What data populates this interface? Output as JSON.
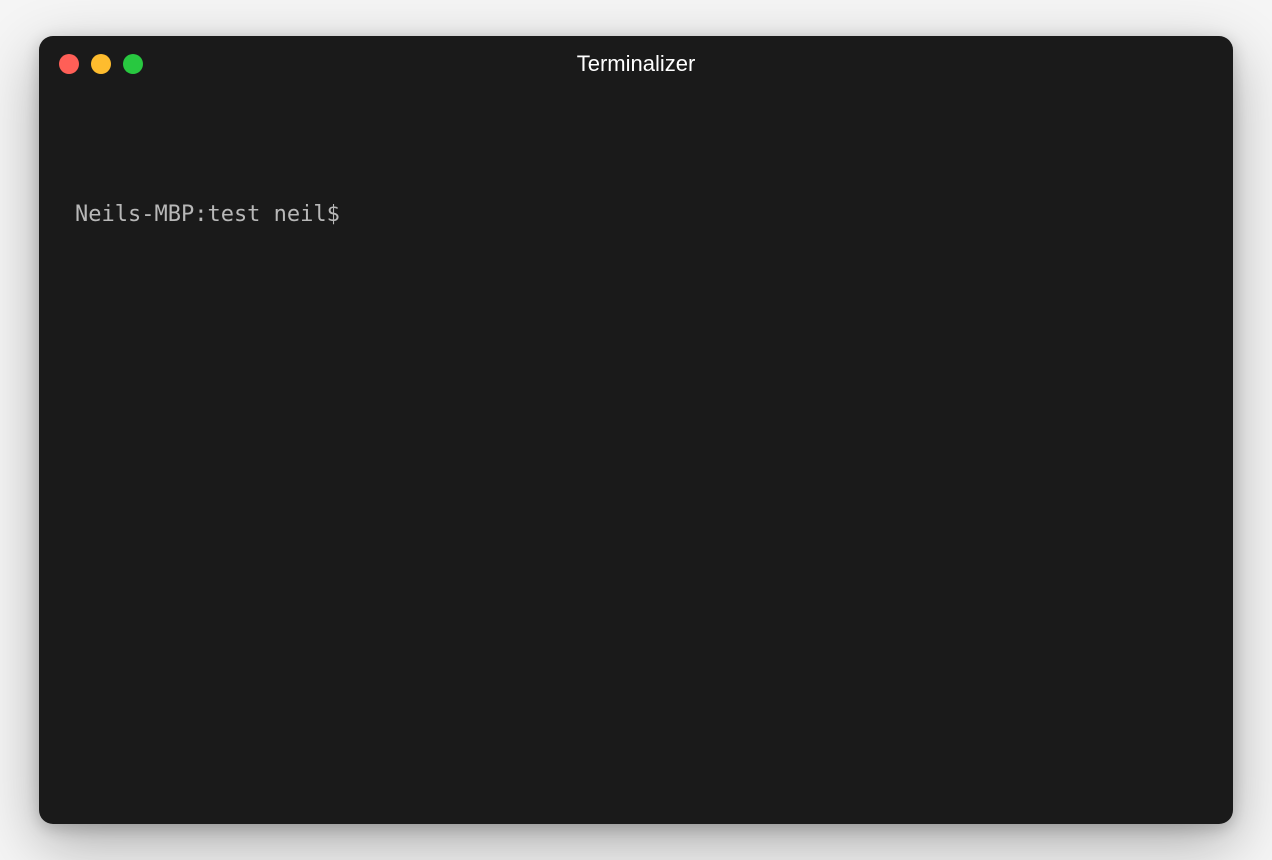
{
  "window": {
    "title": "Terminalizer"
  },
  "terminal": {
    "prompt": "Neils-MBP:test neil$"
  },
  "colors": {
    "close": "#ff5f57",
    "minimize": "#febc2e",
    "maximize": "#28c840",
    "background": "#1a1a1a",
    "text": "#c8c8c8"
  }
}
